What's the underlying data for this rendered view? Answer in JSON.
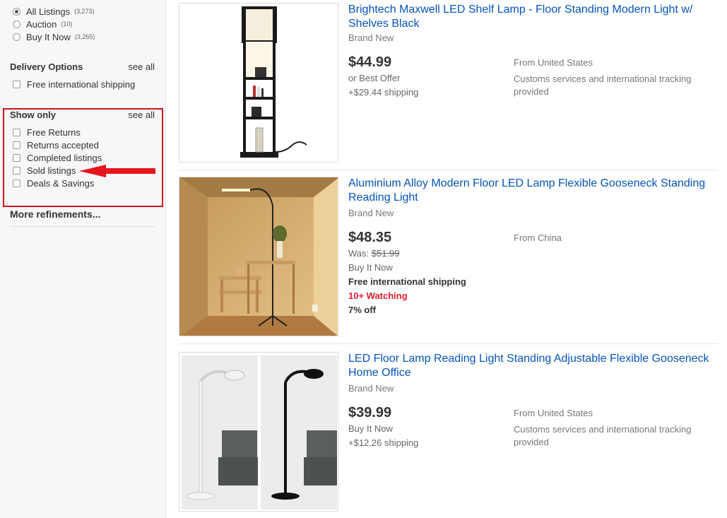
{
  "sidebar": {
    "format_options": [
      {
        "label": "All Listings",
        "count": "(3,273)",
        "selected": true
      },
      {
        "label": "Auction",
        "count": "(10)",
        "selected": false
      },
      {
        "label": "Buy It Now",
        "count": "(3,265)",
        "selected": false
      }
    ],
    "delivery": {
      "title": "Delivery Options",
      "see_all": "see all",
      "items": [
        "Free international shipping"
      ]
    },
    "show_only": {
      "title": "Show only",
      "see_all": "see all",
      "items": [
        "Free Returns",
        "Returns accepted",
        "Completed listings",
        "Sold listings",
        "Deals & Savings"
      ]
    },
    "more_refinements": "More refinements...",
    "annotation_color": "#d0141e"
  },
  "listings": [
    {
      "title": "Brightech Maxwell LED Shelf Lamp - Floor Standing Modern Light w/ Shelves Black",
      "condition": "Brand New",
      "price": "$44.99",
      "line1": "or Best Offer",
      "line2": "+$29.44 shipping",
      "location": "From United States",
      "location_note": "Customs services and international tracking provided",
      "image": "shelf-lamp-image"
    },
    {
      "title": "Aluminium Alloy Modern Floor LED Lamp Flexible Gooseneck Standing Reading Light",
      "condition": "Brand New",
      "price": "$48.35",
      "was_label": "Was:",
      "was_price": "$51.99",
      "buy_format": "Buy It Now",
      "shipping": "Free international shipping",
      "watching": "10+ Watching",
      "discount": "7% off",
      "location": "From China",
      "image": "gooseneck-lamp-room-image"
    },
    {
      "title": "LED Floor Lamp Reading Light Standing Adjustable Flexible Gooseneck Home Office",
      "condition": "Brand New",
      "price": "$39.99",
      "line1": "Buy It Now",
      "line2": "+$12.26 shipping",
      "location": "From United States",
      "location_note": "Customs services and international tracking provided",
      "image": "reading-lamps-image"
    }
  ]
}
